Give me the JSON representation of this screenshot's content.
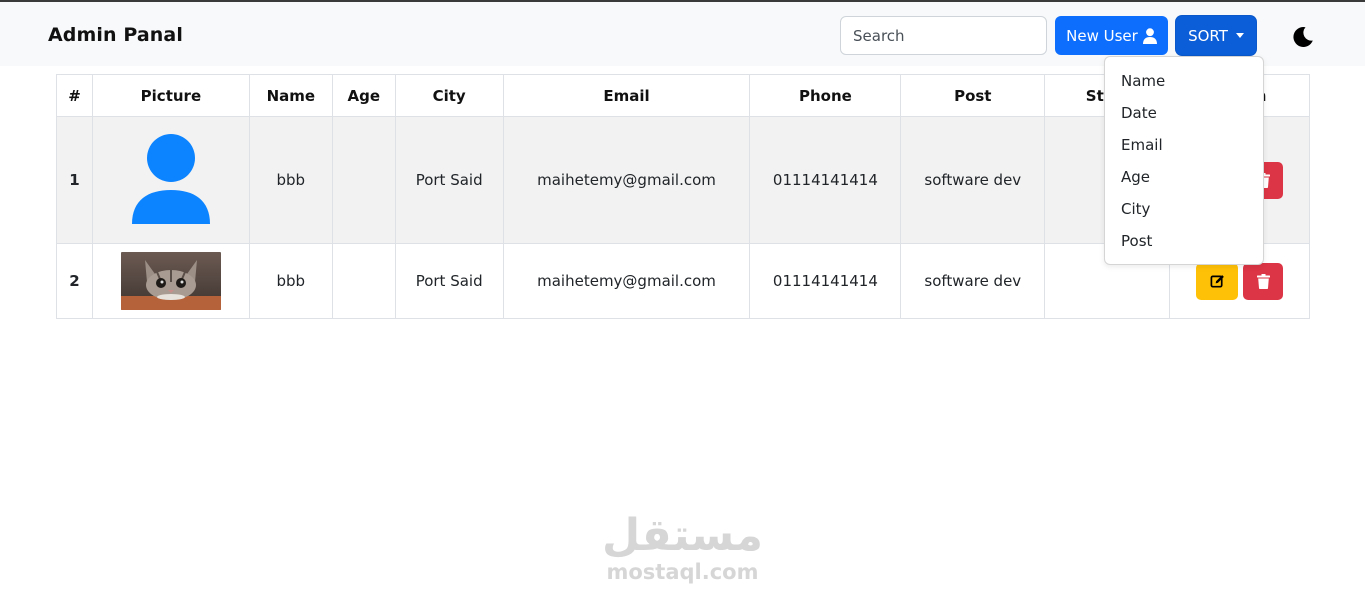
{
  "header": {
    "brand": "Admin Panal",
    "search_placeholder": "Search",
    "new_user_label": "New User",
    "sort_label": "SORT"
  },
  "table": {
    "columns": [
      "#",
      "Picture",
      "Name",
      "Age",
      "City",
      "Email",
      "Phone",
      "Post",
      "Start",
      "Action"
    ],
    "rows": [
      {
        "num": "1",
        "picture": "default-avatar",
        "name": "bbb",
        "age": "",
        "city": "Port Said",
        "email": "maihetemy@gmail.com",
        "phone": "01114141414",
        "post": "software dev",
        "start": ""
      },
      {
        "num": "2",
        "picture": "cat-photo",
        "name": "bbb",
        "age": "",
        "city": "Port Said",
        "email": "maihetemy@gmail.com",
        "phone": "01114141414",
        "post": "software dev",
        "start": ""
      }
    ]
  },
  "sort_menu": {
    "items": [
      "Name",
      "Date",
      "Email",
      "Age",
      "City",
      "Post"
    ]
  },
  "watermark": {
    "arabic": "مستقل",
    "latin": "mostaql.com"
  },
  "colors": {
    "primary": "#0d6efd",
    "sort_active": "#0b5ed7",
    "warning": "#ffc107",
    "danger": "#dc3545",
    "avatar": "#0d84ff",
    "row_stripe": "#f2f2f2"
  }
}
